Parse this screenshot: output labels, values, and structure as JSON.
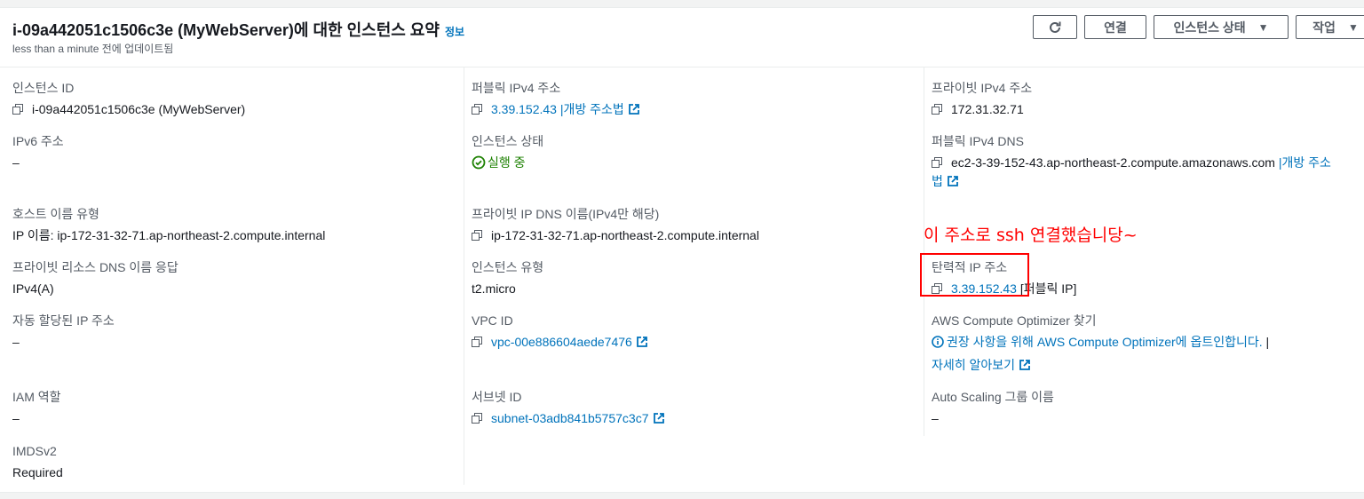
{
  "header": {
    "title": "i-09a442051c1506c3e (MyWebServer)에 대한 인스턴스 요약",
    "info_link": "정보",
    "subtitle": "less than a minute 전에 업데이트됨",
    "buttons": {
      "connect": "연결",
      "instance_state": "인스턴스 상태",
      "actions": "작업"
    }
  },
  "col1": {
    "instance_id": {
      "label": "인스턴스 ID",
      "value": "i-09a442051c1506c3e (MyWebServer)"
    },
    "ipv6": {
      "label": "IPv6 주소",
      "value": "–"
    },
    "hostname_type": {
      "label": "호스트 이름 유형",
      "value": "IP 이름: ip-172-31-32-71.ap-northeast-2.compute.internal"
    },
    "private_dns_response": {
      "label": "프라이빗 리소스 DNS 이름 응답",
      "value": "IPv4(A)"
    },
    "auto_ip": {
      "label": "자동 할당된 IP 주소",
      "value": "–"
    },
    "iam_role": {
      "label": "IAM 역할",
      "value": "–"
    },
    "imdsv2": {
      "label": "IMDSv2",
      "value": "Required"
    }
  },
  "col2": {
    "public_ipv4": {
      "label": "퍼블릭 IPv4 주소",
      "value": "3.39.152.43",
      "open_link": "|개방 주소법"
    },
    "instance_state": {
      "label": "인스턴스 상태",
      "value": "실행 중"
    },
    "private_ip_dns": {
      "label": "프라이빗 IP DNS 이름(IPv4만 해당)",
      "value": "ip-172-31-32-71.ap-northeast-2.compute.internal"
    },
    "instance_type": {
      "label": "인스턴스 유형",
      "value": "t2.micro"
    },
    "vpc_id": {
      "label": "VPC ID",
      "value": "vpc-00e886604aede7476"
    },
    "subnet_id": {
      "label": "서브넷 ID",
      "value": "subnet-03adb841b5757c3c7"
    }
  },
  "col3": {
    "private_ipv4": {
      "label": "프라이빗 IPv4 주소",
      "value": "172.31.32.71"
    },
    "public_dns": {
      "label": "퍼블릭 IPv4 DNS",
      "value": "ec2-3-39-152-43.ap-northeast-2.compute.amazonaws.com",
      "open_link_1": "|개방 주소",
      "open_link_2": "법"
    },
    "elastic_ip": {
      "label": "탄력적 IP 주소",
      "value": "3.39.152.43",
      "suffix": "[퍼블릭 IP]"
    },
    "optimizer": {
      "label": "AWS Compute Optimizer 찾기",
      "value": "권장 사항을 위해 AWS Compute Optimizer에 옵트인합니다.",
      "separator": "|",
      "more": "자세히 알아보기"
    },
    "autoscaling": {
      "label": "Auto Scaling 그룹 이름",
      "value": "–"
    }
  },
  "annotation": "이 주소로 ssh 연결했습니당~",
  "colors": {
    "link": "#0073bb",
    "success": "#1d8102",
    "annotation": "#ff0000",
    "label": "#545b64"
  }
}
